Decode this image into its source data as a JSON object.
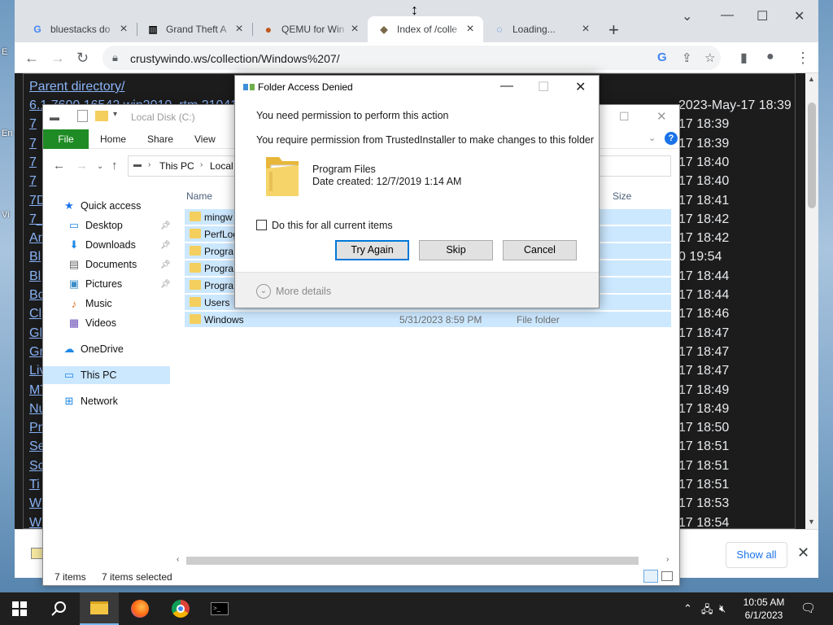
{
  "browser": {
    "tabs": [
      {
        "title": "bluestacks do",
        "favicon": "G",
        "icon": "google-icon"
      },
      {
        "title": "Grand Theft A",
        "favicon": "🏛",
        "icon": "museum-icon"
      },
      {
        "title": "QEMU for Win",
        "favicon": "●",
        "icon": "qemu-icon"
      },
      {
        "title": "Index of /colle",
        "favicon": "◆",
        "icon": "site-icon",
        "active": true
      },
      {
        "title": "Loading...",
        "favicon": "◌",
        "icon": "loading-spinner-icon"
      }
    ],
    "url": "crustywindo.ws/collection/Windows%207/",
    "show_all_label": "Show all",
    "page": {
      "parent_link": "Parent directory/",
      "rows": [
        {
          "name": "6.1.7600.16542.win2010_rtm.21041",
          "date": "2023-May-17 18:39"
        },
        {
          "name": "7",
          "date": "17 18:39"
        },
        {
          "name": "7",
          "date": "17 18:39"
        },
        {
          "name": "7",
          "date": "17 18:40"
        },
        {
          "name": "7",
          "date": "17 18:40"
        },
        {
          "name": "7D",
          "date": "17 18:41"
        },
        {
          "name": "7_",
          "date": "17 18:42"
        },
        {
          "name": "Ar",
          "date": "17 18:42"
        },
        {
          "name": "Bl",
          "date": "0 19:54"
        },
        {
          "name": "Bl",
          "date": "17 18:44"
        },
        {
          "name": "Bo",
          "date": "17 18:44"
        },
        {
          "name": "Cl",
          "date": "17 18:46"
        },
        {
          "name": "Gl",
          "date": "17 18:47"
        },
        {
          "name": "Gr",
          "date": "17 18:47"
        },
        {
          "name": "Liv",
          "date": "17 18:47"
        },
        {
          "name": "MT",
          "date": "17 18:49"
        },
        {
          "name": "Nu",
          "date": "17 18:49"
        },
        {
          "name": "Pr",
          "date": "17 18:50"
        },
        {
          "name": "Se",
          "date": "17 18:51"
        },
        {
          "name": "Sc",
          "date": "17 18:51"
        },
        {
          "name": "Ti",
          "date": "17 18:51"
        },
        {
          "name": "W",
          "date": "17 18:53"
        },
        {
          "name": "W",
          "date": "17 18:54"
        }
      ]
    }
  },
  "explorer": {
    "title": "Local Disk (C:)",
    "ribbon": {
      "file": "File",
      "home": "Home",
      "share": "Share",
      "view": "View"
    },
    "address": {
      "this_pc": "This PC",
      "local": "Local"
    },
    "sidebar": [
      {
        "label": "Quick access",
        "icon": "star-icon"
      },
      {
        "label": "Desktop",
        "icon": "desktop-icon",
        "pinned": true
      },
      {
        "label": "Downloads",
        "icon": "download-icon",
        "pinned": true
      },
      {
        "label": "Documents",
        "icon": "documents-icon",
        "pinned": true
      },
      {
        "label": "Pictures",
        "icon": "pictures-icon",
        "pinned": true
      },
      {
        "label": "Music",
        "icon": "music-icon"
      },
      {
        "label": "Videos",
        "icon": "videos-icon"
      },
      {
        "label": "OneDrive",
        "icon": "cloud-icon"
      },
      {
        "label": "This PC",
        "icon": "computer-icon",
        "selected": true
      },
      {
        "label": "Network",
        "icon": "network-icon"
      }
    ],
    "columns": {
      "name": "Name",
      "size": "Size"
    },
    "files": [
      {
        "name": "mingw",
        "date": "",
        "type": ""
      },
      {
        "name": "PerfLog",
        "date": "",
        "type": ""
      },
      {
        "name": "Progra",
        "date": "",
        "type": ""
      },
      {
        "name": "Progra",
        "date": "",
        "type": ""
      },
      {
        "name": "Progra",
        "date": "",
        "type": ""
      },
      {
        "name": "Users",
        "date": "",
        "type": ""
      },
      {
        "name": "Windows",
        "date": "5/31/2023 8:59 PM",
        "type": "File folder"
      }
    ],
    "status": {
      "items": "7 items",
      "selected": "7 items selected"
    }
  },
  "dialog": {
    "title": "Folder Access Denied",
    "heading": "You need permission to perform this action",
    "message": "You require permission from TrustedInstaller to make changes to this folder",
    "folder_name": "Program Files",
    "folder_date": "Date created: 12/7/2019 1:14 AM",
    "checkbox_label": "Do this for all current items",
    "buttons": {
      "try_again": "Try Again",
      "skip": "Skip",
      "cancel": "Cancel"
    },
    "more_details": "More details"
  },
  "taskbar": {
    "time": "10:05 AM",
    "date": "6/1/2023"
  },
  "colors": {
    "explorer_file_tab": "#1f8b24",
    "selection": "#cce8ff",
    "link": "#8ab4f8",
    "page_bg": "#1c1c1c"
  }
}
